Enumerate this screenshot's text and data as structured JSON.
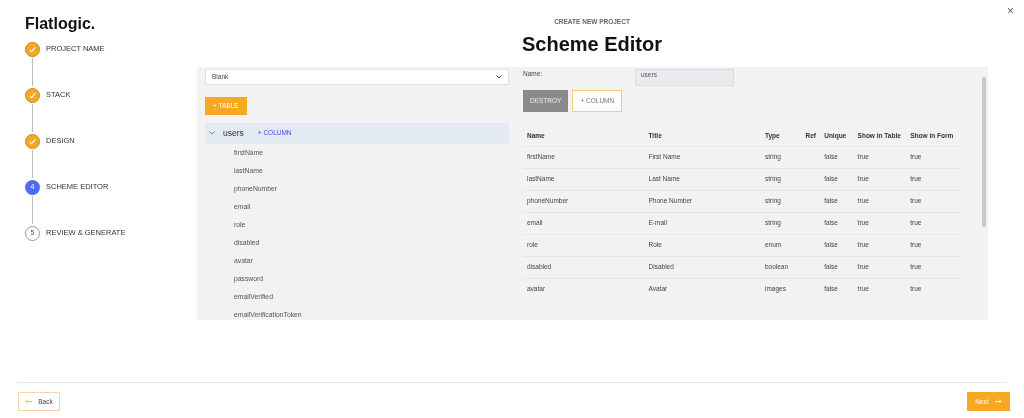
{
  "brand": "Flatlogic.",
  "close": "×",
  "steps": [
    {
      "label": "PROJECT NAME",
      "done": true,
      "selected": false
    },
    {
      "label": "STACK",
      "done": true,
      "selected": false
    },
    {
      "label": "DESIGN",
      "done": true,
      "selected": false
    },
    {
      "label": "SCHEME EDITOR",
      "done": false,
      "selected": true,
      "number": "4"
    },
    {
      "label": "REVIEW & GENERATE",
      "done": false,
      "selected": false,
      "number": "5"
    }
  ],
  "header": {
    "subtitle": "CREATE NEW PROJECT",
    "title": "Scheme Editor"
  },
  "template_select": {
    "value": "Blank"
  },
  "add_table_button": "+ TABLE",
  "tables": [
    {
      "name": "users",
      "expanded": true,
      "add_column": "+ COLUMN",
      "selected": true,
      "fields": [
        "firstName",
        "lastName",
        "phoneNumber",
        "email",
        "role",
        "disabled",
        "avatar",
        "password",
        "emailVerified",
        "emailVerificationToken"
      ]
    }
  ],
  "editor": {
    "name_label": "Name:",
    "name_value": "users",
    "destroy_button": "DESTROY",
    "add_column_button": "+ COLUMN",
    "columns": [
      "Name",
      "Title",
      "Type",
      "Ref",
      "Unique",
      "Show in Table",
      "Show in Form"
    ],
    "rows": [
      [
        "firstName",
        "First Name",
        "string",
        "",
        "false",
        "true",
        "true"
      ],
      [
        "lastName",
        "Last Name",
        "string",
        "",
        "false",
        "true",
        "true"
      ],
      [
        "phoneNumber",
        "Phone Number",
        "string",
        "",
        "false",
        "true",
        "true"
      ],
      [
        "email",
        "E-mail",
        "string",
        "",
        "false",
        "true",
        "true"
      ],
      [
        "role",
        "Role",
        "enum",
        "",
        "false",
        "true",
        "true"
      ],
      [
        "disabled",
        "Disabled",
        "boolean",
        "",
        "false",
        "true",
        "true"
      ],
      [
        "avatar",
        "Avatar",
        "images",
        "",
        "false",
        "true",
        "true"
      ]
    ]
  },
  "footer": {
    "back": "Back",
    "next": "Next"
  }
}
